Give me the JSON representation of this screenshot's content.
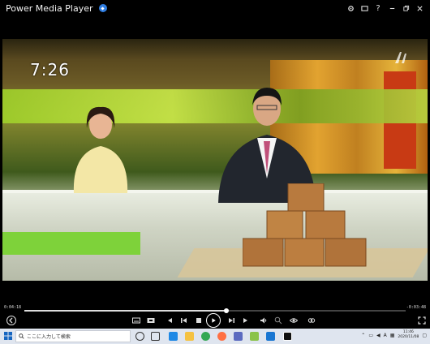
{
  "window": {
    "title": "Power Media Player",
    "badge_icon": "blue-circle-badge-icon",
    "controls": [
      "gear-icon",
      "tv-icon",
      "help-icon",
      "minimize-icon",
      "restore-icon",
      "close-icon"
    ],
    "help_label": "?"
  },
  "video": {
    "clock_overlay": "7:26",
    "logo_icon": "channel-logo-icon"
  },
  "playback": {
    "current_time": "0:04:18",
    "total_time": "-0:03:48",
    "progress": 0.53
  },
  "controls": {
    "back_icon": "back-arrow-icon",
    "subtitles_icon": "subtitles-icon",
    "screen_icon": "screen-icon",
    "rewind_icon": "rewind-icon",
    "prev_icon": "previous-icon",
    "stop_icon": "stop-icon",
    "play_icon": "play-icon",
    "next_icon": "next-icon",
    "forward_icon": "forward-icon",
    "volume_icon": "volume-icon",
    "zoom_icon": "zoom-icon",
    "eye_icon": "eye-icon",
    "link_icon": "link-icon",
    "fullscreen_icon": "fullscreen-icon"
  },
  "taskbar": {
    "search_placeholder": "ここに入力して検索",
    "ime_label": "A",
    "time": "11:46",
    "date": "2020/11/08"
  },
  "colors": {
    "accent": "#2f7de1",
    "taskbar_bg": "#dfe5ef"
  }
}
